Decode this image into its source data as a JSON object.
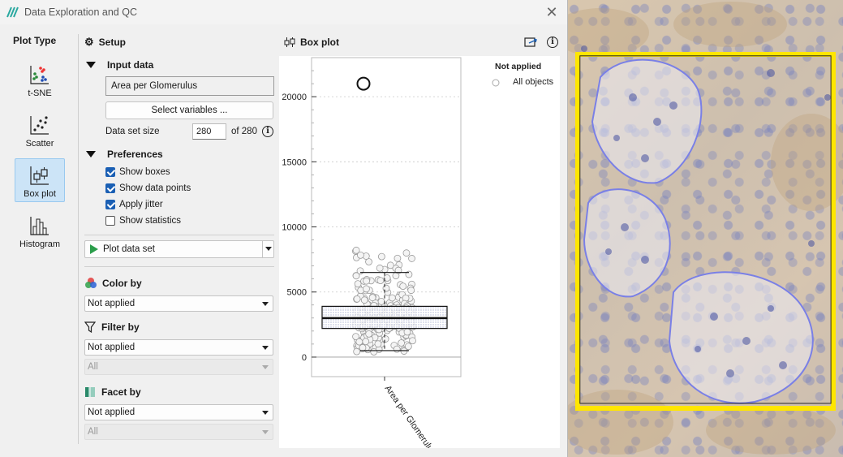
{
  "window": {
    "title": "Data Exploration and QC",
    "close_glyph": "✕"
  },
  "plot_type": {
    "heading": "Plot Type",
    "items": [
      {
        "label": "t-SNE",
        "icon": "tsne-icon",
        "active": false
      },
      {
        "label": "Scatter",
        "icon": "scatter-icon",
        "active": false
      },
      {
        "label": "Box plot",
        "icon": "boxplot-icon",
        "active": true
      },
      {
        "label": "Histogram",
        "icon": "histogram-icon",
        "active": false
      }
    ]
  },
  "setup": {
    "title": "Setup",
    "input_data": {
      "heading": "Input data",
      "variable": "Area per Glomerulus",
      "select_button": "Select variables ...",
      "dataset_size_label": "Data set size",
      "dataset_size_value": "280",
      "dataset_size_of": "of 280"
    },
    "preferences": {
      "heading": "Preferences",
      "options": [
        {
          "label": "Show boxes",
          "checked": true
        },
        {
          "label": "Show data points",
          "checked": true
        },
        {
          "label": "Apply jitter",
          "checked": true
        },
        {
          "label": "Show statistics",
          "checked": false
        }
      ]
    },
    "plot_button": "Plot data set",
    "color_by": {
      "heading": "Color by",
      "value": "Not applied"
    },
    "filter_by": {
      "heading": "Filter by",
      "value": "Not applied",
      "sub_value": "All"
    },
    "facet_by": {
      "heading": "Facet by",
      "value": "Not applied",
      "sub_value": "All"
    }
  },
  "plot": {
    "title": "Box plot",
    "legend_title": "Not applied",
    "legend_item": "All objects"
  },
  "chart_data": {
    "type": "box",
    "categories": [
      "Area per Glomerulus"
    ],
    "yticks": [
      0,
      5000,
      10000,
      15000,
      20000
    ],
    "ylim": [
      -1500,
      23000
    ],
    "box": {
      "q1": 2200,
      "median": 3000,
      "q3": 3900,
      "whisker_low": 500,
      "whisker_high": 6500
    },
    "outliers": [
      21000
    ],
    "points_range": [
      400,
      8300
    ],
    "points_count": 280
  },
  "colors": {
    "accent": "#1a5fb4",
    "annotation_yellow": "#ffe600",
    "annotation_blue": "#6b74e0"
  }
}
